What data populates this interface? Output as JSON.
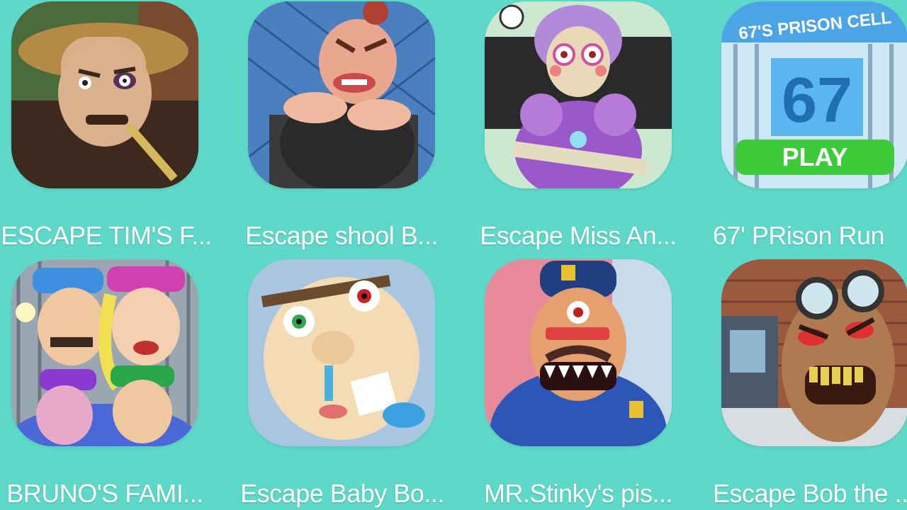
{
  "apps": [
    {
      "title": "ESCAPE TIM'S F...",
      "icon": "scarecrow-farmer-icon"
    },
    {
      "title": "Escape shool B...",
      "icon": "bully-kid-icon"
    },
    {
      "title": "Escape Miss An...",
      "icon": "robot-teacher-icon"
    },
    {
      "title": "67' PRison Run",
      "icon": "prison-cell-67-icon",
      "sign_text": "67'S PRISON CELL",
      "play_text": "PLAY",
      "number_text": "67"
    },
    {
      "title": "BRUNO'S  FAMI...",
      "icon": "police-family-icon"
    },
    {
      "title": "Escape Baby Bo...",
      "icon": "baby-face-icon"
    },
    {
      "title": "MR.Stinky's pis...",
      "icon": "cyclops-police-icon"
    },
    {
      "title": "Escape Bob the ...",
      "icon": "scientist-bob-icon"
    }
  ],
  "colors": {
    "background": "#5ed8c8",
    "label": "#ffffff",
    "play_button": "#3ecb3a"
  }
}
